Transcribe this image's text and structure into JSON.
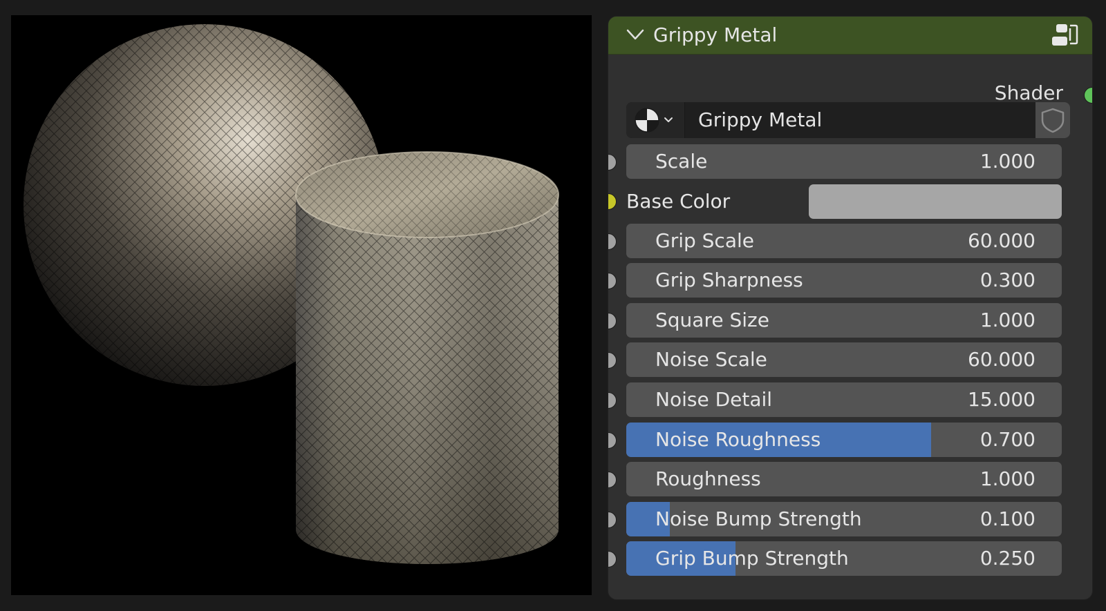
{
  "node": {
    "title": "Grippy Metal",
    "output_label": "Shader",
    "group_name": "Grippy Metal",
    "colors": {
      "header": "#3d5323",
      "shader_socket": "#5fc35a",
      "color_socket": "#c7c729",
      "float_socket": "#a1a1a1",
      "slider_fill": "#4772b3",
      "base_color_value": "#a6a6a6"
    },
    "inputs": [
      {
        "label": "Scale",
        "value": "1.000"
      },
      {
        "label": "Base Color"
      },
      {
        "label": "Grip Scale",
        "value": "60.000"
      },
      {
        "label": "Grip Sharpness",
        "value": "0.300"
      },
      {
        "label": "Square Size",
        "value": "1.000"
      },
      {
        "label": "Noise Scale",
        "value": "60.000"
      },
      {
        "label": "Noise Detail",
        "value": "15.000"
      },
      {
        "label": "Noise Roughness",
        "value": "0.700",
        "fill": 0.7
      },
      {
        "label": "Roughness",
        "value": "1.000"
      },
      {
        "label": "Noise Bump Strength",
        "value": "0.100",
        "fill": 0.1
      },
      {
        "label": "Grip Bump Strength",
        "value": "0.250",
        "fill": 0.25
      }
    ]
  },
  "icons": {
    "collapse": "chevron-down-icon",
    "node_group": "node-group-icon",
    "datablock": "material-sphere-icon",
    "fake_user": "shield-icon"
  }
}
